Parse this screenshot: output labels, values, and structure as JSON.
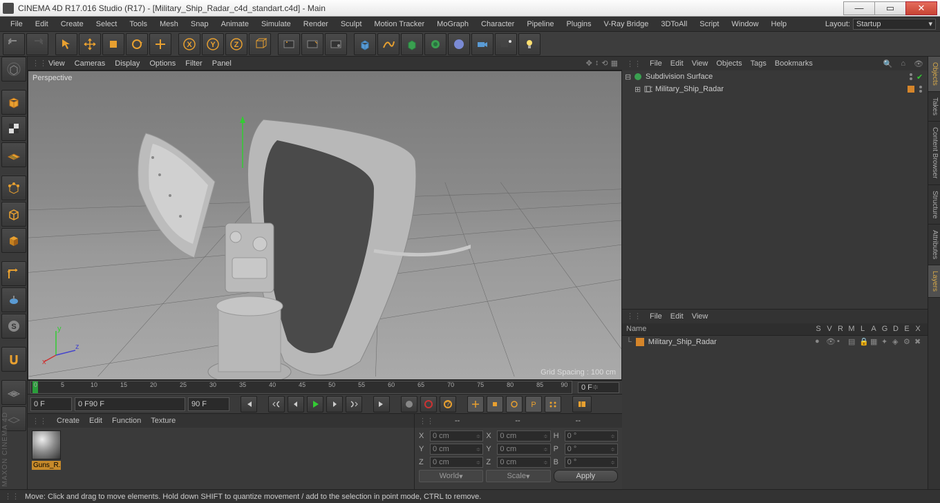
{
  "title": "CINEMA 4D R17.016 Studio (R17) - [Military_Ship_Radar_c4d_standart.c4d] - Main",
  "menu": [
    "File",
    "Edit",
    "Create",
    "Select",
    "Tools",
    "Mesh",
    "Snap",
    "Animate",
    "Simulate",
    "Render",
    "Sculpt",
    "Motion Tracker",
    "MoGraph",
    "Character",
    "Pipeline",
    "Plugins",
    "V-Ray Bridge",
    "3DToAll",
    "Script",
    "Window",
    "Help"
  ],
  "layout_label": "Layout:",
  "layout_value": "Startup",
  "viewport_menu": [
    "View",
    "Cameras",
    "Display",
    "Options",
    "Filter",
    "Panel"
  ],
  "viewport_label": "Perspective",
  "grid_spacing": "Grid Spacing : 100 cm",
  "timeline": {
    "start": 0,
    "end": 90,
    "current": "0 F",
    "range_start": "0 F",
    "range_start2": "0 F",
    "range_end": "90 F",
    "range_end2": "90 F"
  },
  "material_menu": [
    "Create",
    "Edit",
    "Function",
    "Texture"
  ],
  "material": {
    "name": "Guns_R..."
  },
  "coord": {
    "header": [
      "--",
      "--",
      "--"
    ],
    "rows": [
      {
        "axis": "X",
        "pos": "0 cm",
        "axis2": "X",
        "size": "0 cm",
        "rot_axis": "H",
        "rot": "0 °"
      },
      {
        "axis": "Y",
        "pos": "0 cm",
        "axis2": "Y",
        "size": "0 cm",
        "rot_axis": "P",
        "rot": "0 °"
      },
      {
        "axis": "Z",
        "pos": "0 cm",
        "axis2": "Z",
        "size": "0 cm",
        "rot_axis": "B",
        "rot": "0 °"
      }
    ],
    "world": "World",
    "scale": "Scale",
    "apply": "Apply"
  },
  "objects": {
    "menu": [
      "File",
      "Edit",
      "View",
      "Objects",
      "Tags",
      "Bookmarks"
    ],
    "tree": [
      {
        "name": "Subdivision Surface",
        "icon": "subsurf",
        "level": 0,
        "expanded": true
      },
      {
        "name": "Military_Ship_Radar",
        "icon": "null",
        "level": 1,
        "expanded": false
      }
    ]
  },
  "layers": {
    "menu": [
      "File",
      "Edit",
      "View"
    ],
    "cols_name": "Name",
    "cols": [
      "S",
      "V",
      "R",
      "M",
      "L",
      "A",
      "G",
      "D",
      "E",
      "X"
    ],
    "rows": [
      {
        "name": "Military_Ship_Radar",
        "color": "#d5852a"
      }
    ]
  },
  "right_tabs": [
    "Objects",
    "Takes",
    "Content Browser",
    "Structure",
    "Attributes",
    "Layers"
  ],
  "status": "Move: Click and drag to move elements. Hold down SHIFT to quantize movement / add to the selection in point mode, CTRL to remove.",
  "brand": "MAXON CINEMA 4D"
}
